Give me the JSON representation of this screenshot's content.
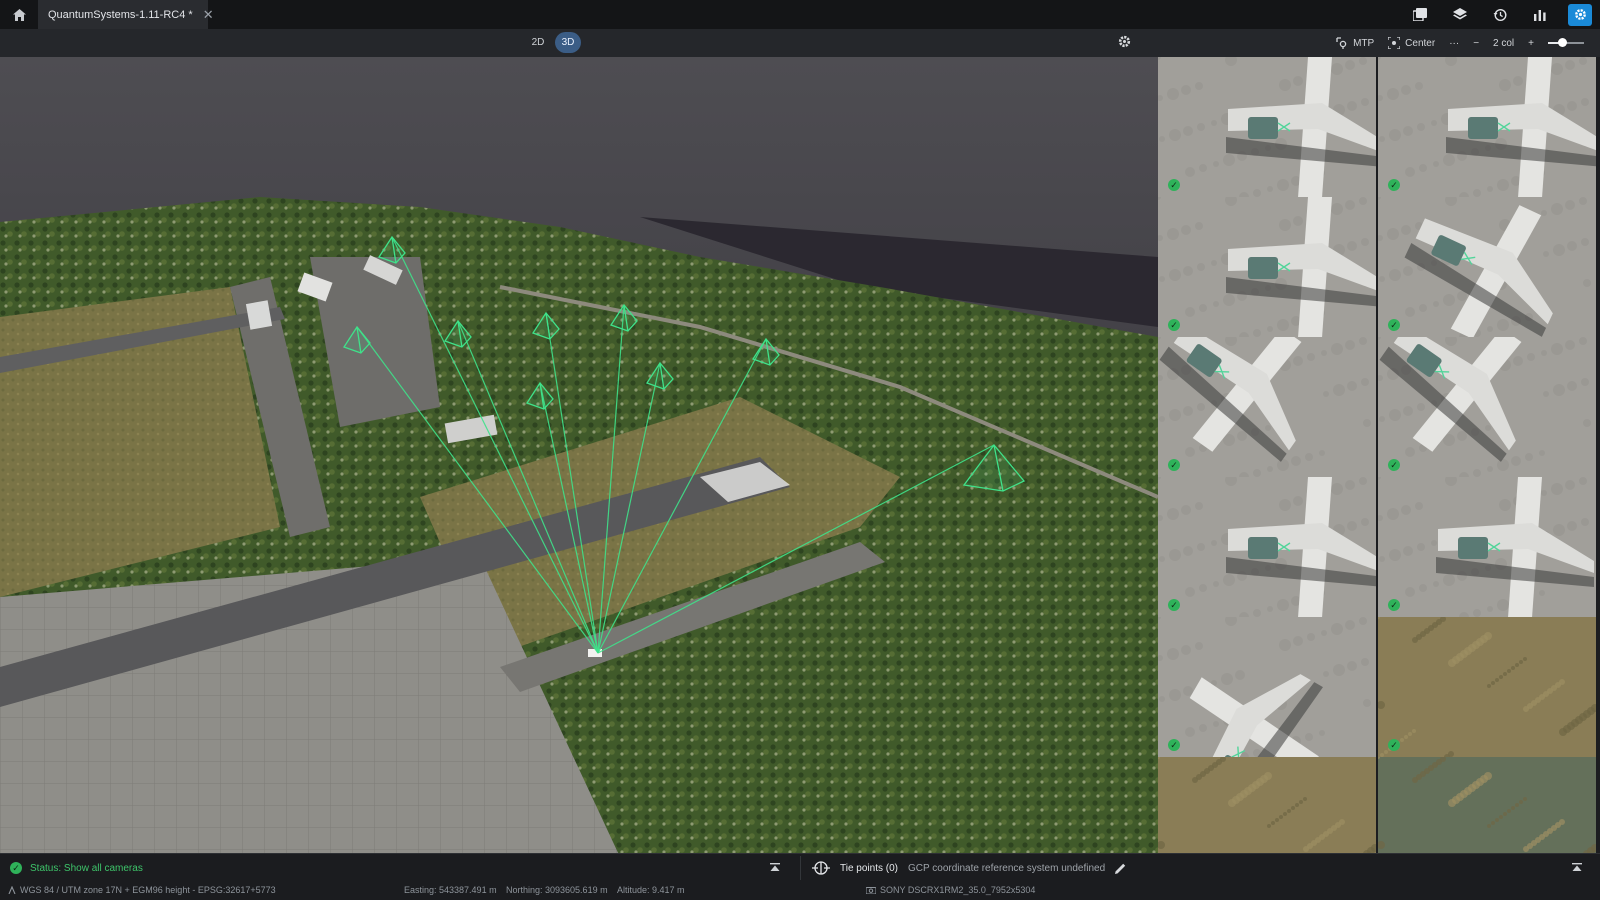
{
  "app": {
    "tab_title": "QuantumSystems-1.11-RC4 *",
    "home_icon": "home-icon",
    "close_icon": "close-icon",
    "title_icons": [
      "gallery-icon",
      "layers-icon",
      "history-icon",
      "chart-icon",
      "settings-icon"
    ],
    "accent_color": "#1a8ad8"
  },
  "viewer": {
    "mode_2d": "2D",
    "mode_3d": "3D",
    "active_mode": "3D",
    "settings_icon": "gear-icon",
    "camera_ray_color": "#3fe28a"
  },
  "gallery": {
    "mtp_label": "MTP",
    "center_label": "Center",
    "more_label": "···",
    "minus_label": "−",
    "columns_label": "2 col",
    "plus_label": "+",
    "zoom_level": 0.4,
    "thumbnails": [
      {
        "checked": true
      },
      {
        "checked": true
      },
      {
        "checked": true
      },
      {
        "checked": true
      },
      {
        "checked": true
      },
      {
        "checked": true
      },
      {
        "checked": true
      },
      {
        "checked": true
      },
      {
        "checked": true
      },
      {
        "checked": true
      },
      {
        "checked": false
      },
      {
        "checked": false
      }
    ]
  },
  "status": {
    "message": "Status: Show all cameras",
    "tie_points": "Tie points (0)",
    "gcp_message": "GCP coordinate reference system undefined",
    "status_color": "#3ec46a"
  },
  "info": {
    "crs": "WGS 84 / UTM zone 17N + EGM96 height - EPSG:32617+5773",
    "easting": "Easting: 543387.491 m",
    "northing": "Northing: 3093605.619 m",
    "altitude": "Altitude: 9.417 m",
    "camera": "SONY DSCRX1RM2_35.0_7952x5304"
  }
}
